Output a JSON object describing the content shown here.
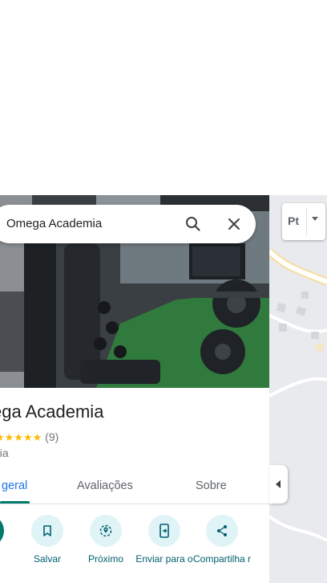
{
  "search": {
    "query": "Omega Academia"
  },
  "place": {
    "title": "ega Academia",
    "stars": "★★★★★",
    "review_count": "(9)",
    "category": "nia"
  },
  "tabs": [
    {
      "label": "geral",
      "active": true
    },
    {
      "label": "Avaliações",
      "active": false
    },
    {
      "label": "Sobre",
      "active": false
    }
  ],
  "actions": [
    {
      "label": "s",
      "icon": "directions-icon"
    },
    {
      "label": "Salvar",
      "icon": "bookmark-icon"
    },
    {
      "label": "Próximo",
      "icon": "nearby-icon"
    },
    {
      "label": "Enviar para o",
      "icon": "send-to-phone-icon"
    },
    {
      "label": "Compartilha r",
      "icon": "share-icon"
    }
  ],
  "map": {
    "layers_label": "Pt"
  },
  "colors": {
    "accent": "#00796b",
    "tab_active": "#1a73e8",
    "action_bg": "#e0f4f7",
    "star": "#fbbc04"
  }
}
